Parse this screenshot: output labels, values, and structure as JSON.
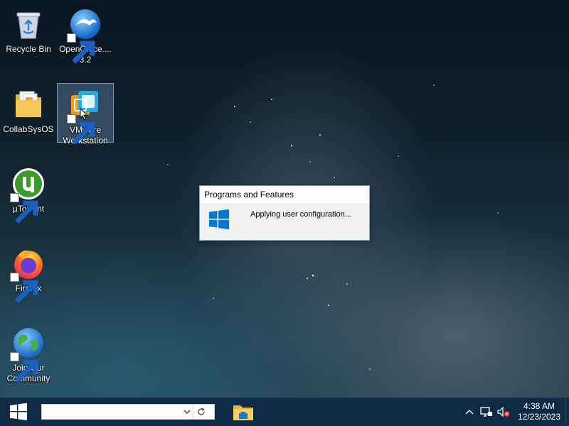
{
  "desktop": {
    "icons": [
      {
        "label": "Recycle Bin",
        "icon": "recycle-bin-icon"
      },
      {
        "label": "OpenOffice.... 3.2",
        "icon": "openoffice-icon"
      },
      {
        "label": "CollabSysOS",
        "icon": "folder-icon"
      },
      {
        "label": "VMware Workstation",
        "icon": "vmware-icon"
      },
      {
        "label": "µTorrent",
        "icon": "utorrent-icon"
      },
      {
        "label": "Firefox",
        "icon": "firefox-icon"
      },
      {
        "label": "Join Our Community",
        "icon": "globe-icon"
      }
    ]
  },
  "dialog": {
    "title": "Programs and Features",
    "message": "Applying user configuration..."
  },
  "taskbar": {
    "search_value": "",
    "pinned": [
      {
        "name": "File Explorer",
        "icon": "file-explorer-icon"
      }
    ],
    "tray_icons": [
      "chevron-up-icon",
      "network-icon",
      "volume-muted-icon"
    ],
    "clock": {
      "time": "4:38 AM",
      "date": "12/23/2023"
    }
  },
  "colors": {
    "taskbar": "#0f2a44",
    "selection": "#7aa0c8",
    "windows_blue": "#0078d7"
  }
}
